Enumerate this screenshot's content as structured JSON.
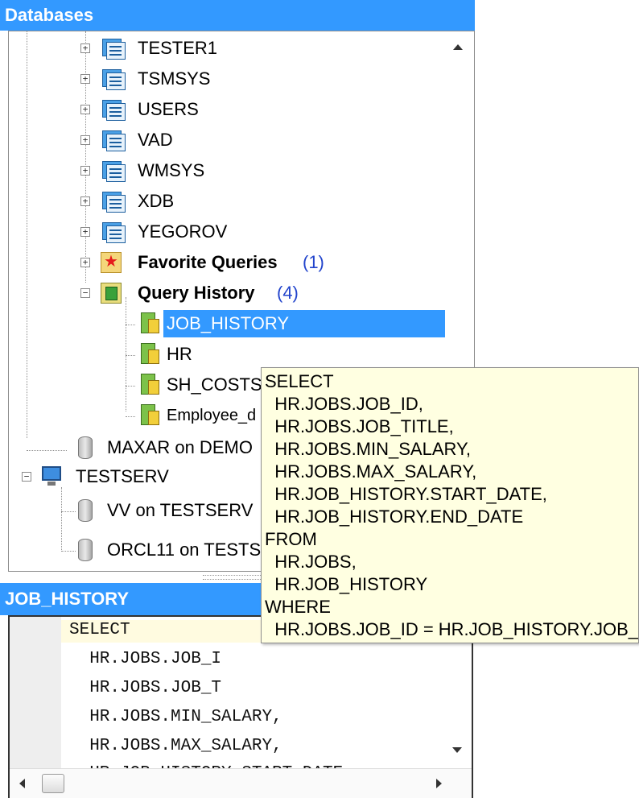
{
  "databases_panel": {
    "title": "Databases",
    "schemas": [
      {
        "label": "TESTER1"
      },
      {
        "label": "TSMSYS"
      },
      {
        "label": "USERS"
      },
      {
        "label": "VAD"
      },
      {
        "label": "WMSYS"
      },
      {
        "label": "XDB"
      },
      {
        "label": "YEGOROV"
      }
    ],
    "favorite_queries": {
      "label": "Favorite Queries",
      "count": "(1)"
    },
    "query_history": {
      "label": "Query History",
      "count": "(4)",
      "items": [
        {
          "label": "JOB_HISTORY"
        },
        {
          "label": "HR"
        },
        {
          "label": "SH_COSTS"
        },
        {
          "label": "Employee_d"
        }
      ]
    },
    "maxar": {
      "label": "MAXAR on DEMO"
    },
    "testserv": {
      "label": "TESTSERV",
      "items": [
        {
          "label": "VV on TESTSERV"
        },
        {
          "label": "ORCL11 on TESTS"
        }
      ]
    }
  },
  "editor_panel": {
    "title": "JOB_HISTORY",
    "lines": [
      "SELECT",
      "  HR.JOBS.JOB_I",
      "  HR.JOBS.JOB_T",
      "  HR.JOBS.MIN_SALARY,",
      "  HR.JOBS.MAX_SALARY,",
      "  HR.JOB_HISTORY.START_DATE,"
    ]
  },
  "tooltip": {
    "lines": [
      "SELECT",
      "  HR.JOBS.JOB_ID,",
      "  HR.JOBS.JOB_TITLE,",
      "  HR.JOBS.MIN_SALARY,",
      "  HR.JOBS.MAX_SALARY,",
      "  HR.JOB_HISTORY.START_DATE,",
      "  HR.JOB_HISTORY.END_DATE",
      "FROM",
      "  HR.JOBS,",
      "  HR.JOB_HISTORY",
      "WHERE",
      "  HR.JOBS.JOB_ID = HR.JOB_HISTORY.JOB_ID"
    ]
  },
  "colors": {
    "header_bg": "#3399ff",
    "selection_bg": "#3399ff",
    "tooltip_bg": "#ffffe1",
    "count_text": "#2244cc"
  }
}
